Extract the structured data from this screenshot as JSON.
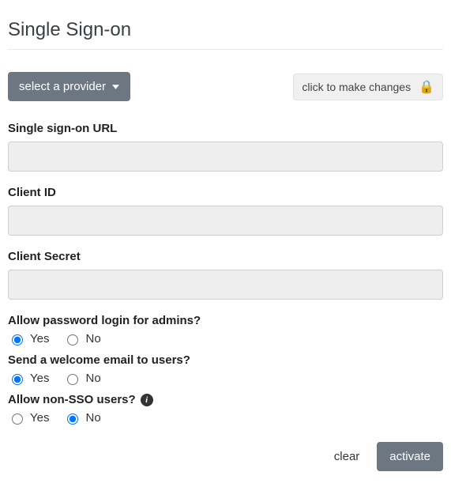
{
  "title": "Single Sign-on",
  "top": {
    "provider_button": "select a provider",
    "lock_button": "click to make changes"
  },
  "fields": {
    "sso_url": {
      "label": "Single sign-on URL",
      "value": ""
    },
    "client_id": {
      "label": "Client ID",
      "value": ""
    },
    "client_secret": {
      "label": "Client Secret",
      "value": ""
    }
  },
  "options": {
    "admin_password_login": {
      "label": "Allow password login for admins?",
      "yes": "Yes",
      "no": "No",
      "selected": "yes"
    },
    "welcome_email": {
      "label": "Send a welcome email to users?",
      "yes": "Yes",
      "no": "No",
      "selected": "yes"
    },
    "allow_non_sso": {
      "label": "Allow non-SSO users?",
      "yes": "Yes",
      "no": "No",
      "selected": "no"
    }
  },
  "footer": {
    "clear": "clear",
    "activate": "activate"
  }
}
